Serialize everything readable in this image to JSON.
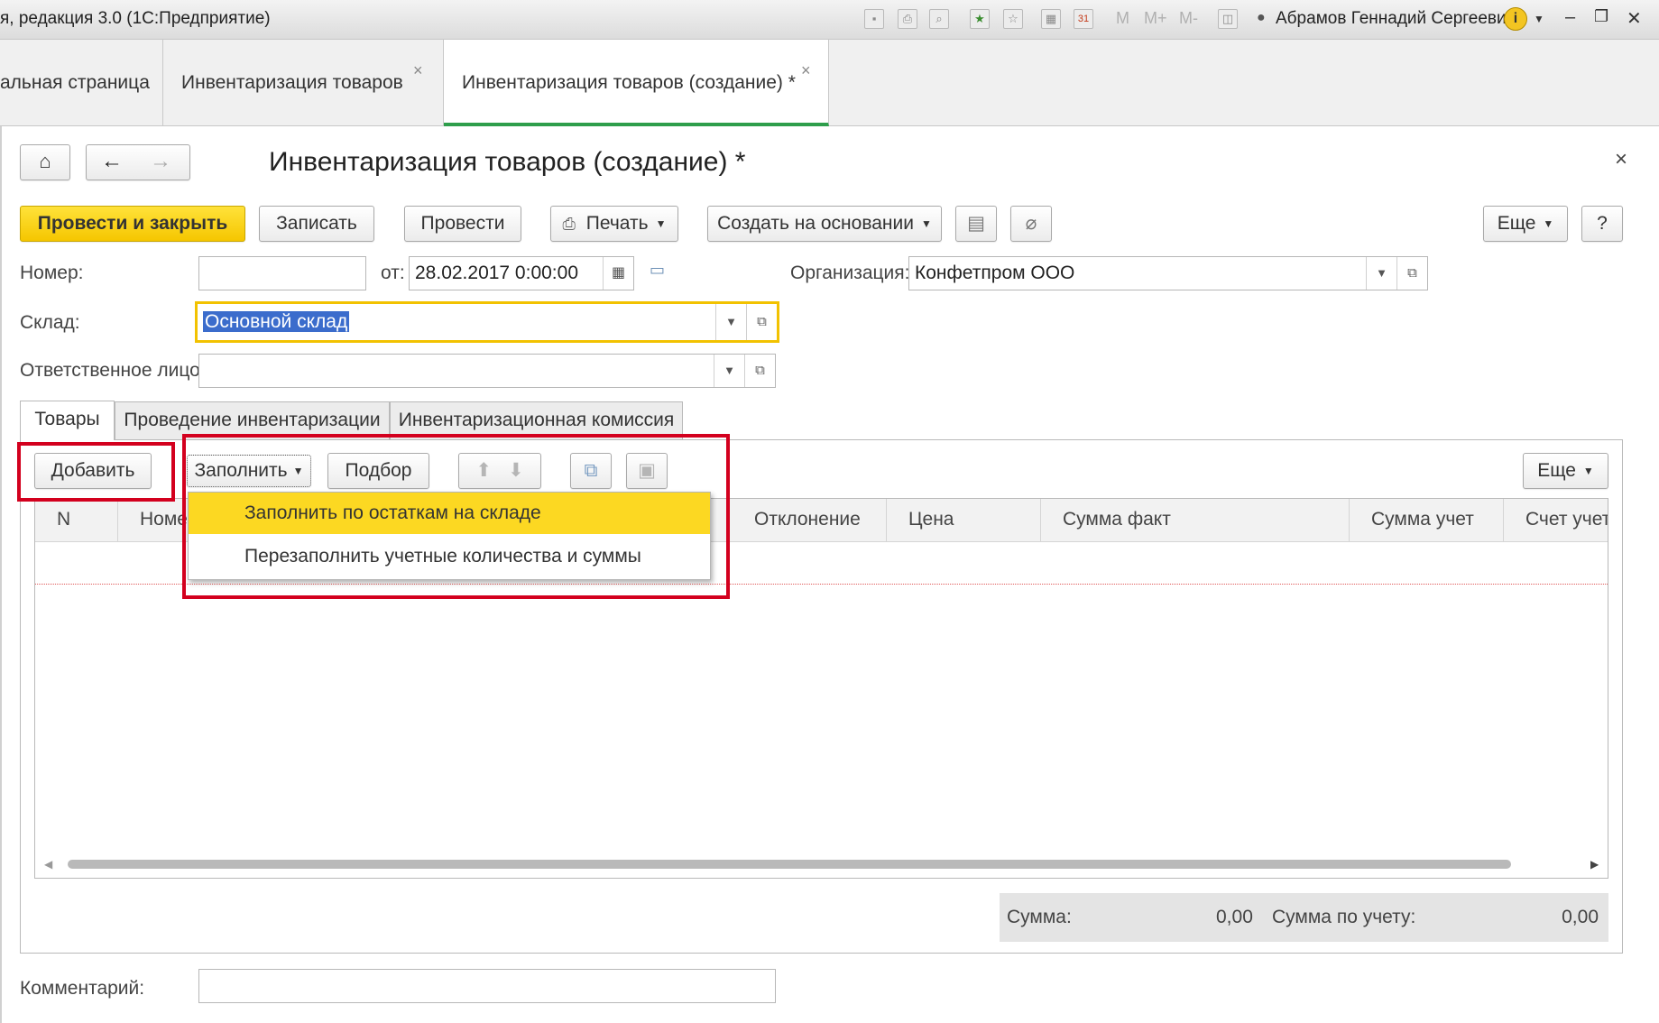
{
  "window": {
    "title": "я, редакция 3.0  (1С:Предприятие)",
    "user_name": "Абрамов Геннадий Сергеевич",
    "m_labels": [
      "M",
      "M+",
      "M-"
    ]
  },
  "doc_tabs": [
    {
      "label": "альная страница"
    },
    {
      "label": "Инвентаризация товаров"
    },
    {
      "label": "Инвентаризация товаров (создание) *"
    }
  ],
  "form": {
    "title": "Инвентаризация товаров (создание) *",
    "toolbar": {
      "post_and_close": "Провести и закрыть",
      "save": "Записать",
      "post": "Провести",
      "print": "Печать",
      "create_based_on": "Создать на основании",
      "more": "Еще",
      "help": "?"
    },
    "fields": {
      "number_label": "Номер:",
      "number_value": "",
      "date_label": "от:",
      "date_value": "28.02.2017  0:00:00",
      "org_label": "Организация:",
      "org_value": "Конфетпром ООО",
      "warehouse_label": "Склад:",
      "warehouse_value": "Основной склад",
      "responsible_label": "Ответственное лицо:",
      "responsible_value": "",
      "comment_label": "Комментарий:",
      "comment_value": ""
    },
    "inner_tabs": [
      "Товары",
      "Проведение инвентаризации",
      "Инвентаризационная комиссия"
    ],
    "table_toolbar": {
      "add": "Добавить",
      "fill": "Заполнить",
      "select": "Подбор",
      "more": "Еще"
    },
    "fill_menu": [
      "Заполнить по остаткам на складе",
      "Перезаполнить учетные количества и суммы"
    ],
    "columns": [
      "N",
      "Номе",
      "Отклонение",
      "Цена",
      "Сумма факт",
      "Сумма учет",
      "Счет учет"
    ],
    "summary": {
      "sum_label": "Сумма:",
      "sum_value": "0,00",
      "acc_sum_label": "Сумма по учету:",
      "acc_sum_value": "0,00"
    }
  },
  "colors": {
    "accent_yellow": "#f5c600",
    "active_tab_underline": "#2e9e4b",
    "highlight_red": "#d3001e",
    "menu_highlight": "#fcd822",
    "focus_border": "#f2c200"
  }
}
